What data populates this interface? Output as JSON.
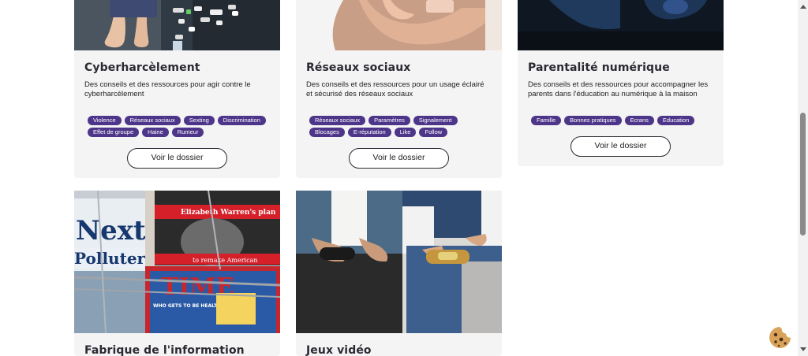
{
  "cards": [
    {
      "title": "Cyberharcèlement",
      "description": "Des conseils et des ressources pour agir contre le cyberharcèlement",
      "tags": [
        "Violence",
        "Réseaux sociaux",
        "Sexting",
        "Discrimination",
        "Effet de groupe",
        "Haine",
        "Rumeur"
      ],
      "button": "Voir le dossier"
    },
    {
      "title": "Réseaux sociaux",
      "description": "Des conseils et des ressources pour un usage éclairé et sécurisé des réseaux sociaux",
      "tags": [
        "Réseaux sociaux",
        "Paramètres",
        "Signalement",
        "Blocages",
        "E-réputation",
        "Like",
        "Follow"
      ],
      "button": "Voir le dossier"
    },
    {
      "title": "Parentalité numérique",
      "description": "Des conseils et des ressources pour accompagner les parents dans l'éducation au numérique à la maison",
      "tags": [
        "Famille",
        "Bonnes pratiques",
        "Ecrans",
        "Education"
      ],
      "button": "Voir le dossier"
    },
    {
      "title": "Fabrique de l'information",
      "magazine_text": [
        "Elizabeth Warren's plan",
        "Next!",
        "Polluters",
        "TIME",
        "WHO GETS TO BE HEALTHY",
        "to remake American"
      ]
    },
    {
      "title": "Jeux vidéo"
    }
  ],
  "colors": {
    "tag_bg": "#4d3589",
    "card_bg": "#f4f4f5",
    "title": "#2a2a33"
  }
}
